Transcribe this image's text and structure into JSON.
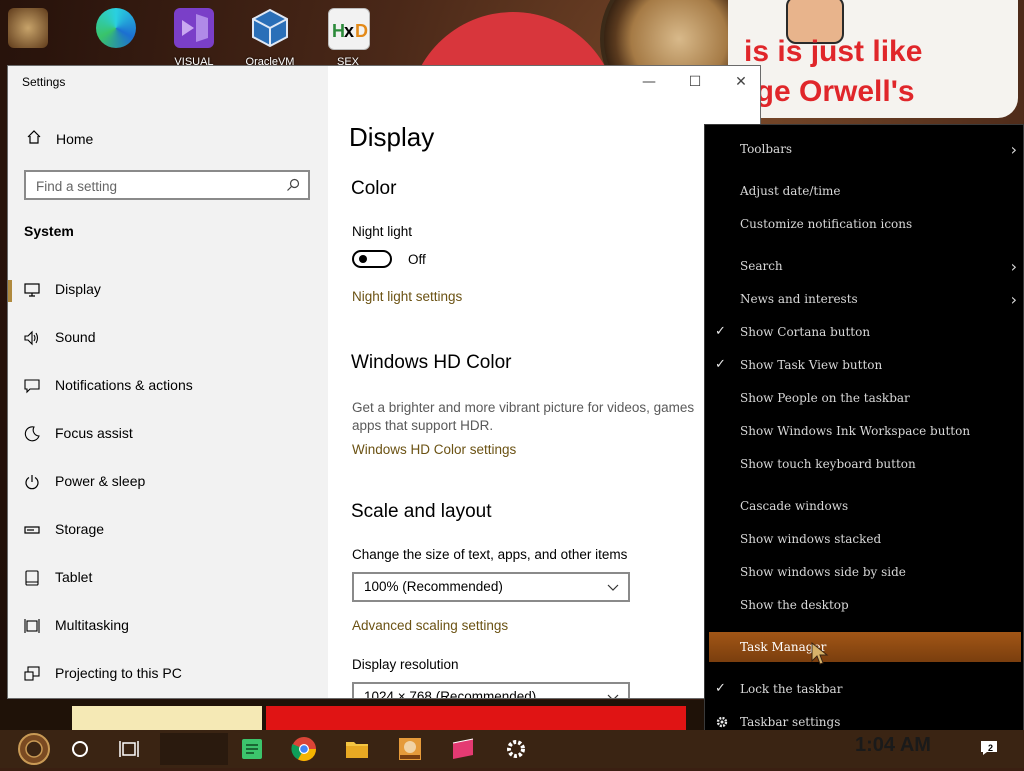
{
  "desktop": {
    "icons": [
      {
        "label": ""
      },
      {
        "label": ""
      },
      {
        "label": "VISUAL"
      },
      {
        "label": "OracleVM"
      },
      {
        "label": "SEX"
      }
    ],
    "meme_text_line1": "is is just like",
    "meme_text_line2": "rge Orwell's"
  },
  "window": {
    "title": "Settings",
    "minimize": "—",
    "maximize": "☐",
    "close": "✕"
  },
  "sidebar": {
    "home": "Home",
    "search_placeholder": "Find a setting",
    "section": "System",
    "items": [
      {
        "label": "Display",
        "icon": "monitor-icon",
        "selected": true
      },
      {
        "label": "Sound",
        "icon": "speaker-icon"
      },
      {
        "label": "Notifications & actions",
        "icon": "message-icon"
      },
      {
        "label": "Focus assist",
        "icon": "moon-icon"
      },
      {
        "label": "Power & sleep",
        "icon": "power-icon"
      },
      {
        "label": "Storage",
        "icon": "storage-icon"
      },
      {
        "label": "Tablet",
        "icon": "tablet-icon"
      },
      {
        "label": "Multitasking",
        "icon": "multitasking-icon"
      },
      {
        "label": "Projecting to this PC",
        "icon": "projector-icon"
      }
    ]
  },
  "content": {
    "title": "Display",
    "color_section": "Color",
    "night_light_label": "Night light",
    "night_light_state": "Off",
    "night_light_settings": "Night light settings",
    "hd_section": "Windows HD Color",
    "hd_desc_line1": "Get a brighter and more vibrant picture for videos, games",
    "hd_desc_line2": "apps that support HDR.",
    "hd_settings": "Windows HD Color settings",
    "scale_section": "Scale and layout",
    "scale_label": "Change the size of text, apps, and other items",
    "scale_value": "100% (Recommended)",
    "advanced_scaling": "Advanced scaling settings",
    "resolution_label": "Display resolution",
    "resolution_value": "1024 × 768 (Recommended)"
  },
  "context_menu": {
    "items": [
      {
        "label": "Toolbars",
        "submenu": true
      },
      {
        "label": "Adjust date/time"
      },
      {
        "label": "Customize notification icons"
      },
      {
        "label": "Search",
        "submenu": true
      },
      {
        "label": "News and interests",
        "submenu": true
      },
      {
        "label": "Show Cortana button",
        "checked": true
      },
      {
        "label": "Show Task View button",
        "checked": true
      },
      {
        "label": "Show People on the taskbar"
      },
      {
        "label": "Show Windows Ink Workspace button"
      },
      {
        "label": "Show touch keyboard button"
      },
      {
        "label": "Cascade windows"
      },
      {
        "label": "Show windows stacked"
      },
      {
        "label": "Show windows side by side"
      },
      {
        "label": "Show the desktop"
      },
      {
        "label": "Task Manager",
        "highlighted": true
      },
      {
        "label": "Lock the taskbar",
        "checked": true
      },
      {
        "label": "Taskbar settings",
        "icon": "gear-icon"
      }
    ]
  },
  "taskbar": {
    "clock": "1:04 AM",
    "notification_count": "2"
  },
  "colors": {
    "accent_link": "#6b5213",
    "selection_bar": "#b08a3e",
    "menu_highlight": "#a25616",
    "menu_bg": "#000000",
    "taskbar": "#3a2413"
  }
}
